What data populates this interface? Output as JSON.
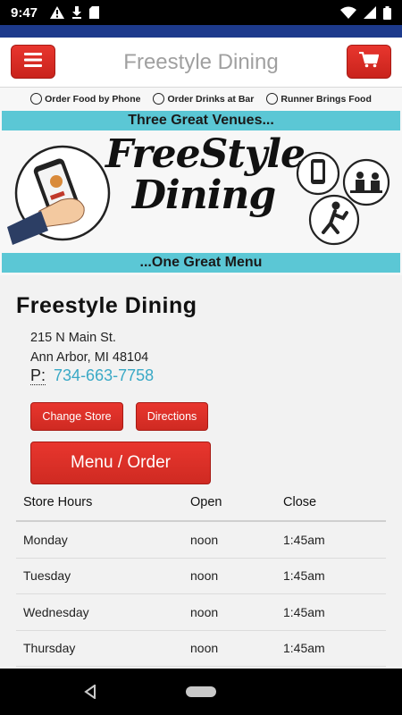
{
  "status_bar": {
    "time": "9:47",
    "left_icons": [
      "alert-icon",
      "download-icon",
      "sd-card-icon"
    ],
    "right_icons": [
      "wifi-icon",
      "signal-icon",
      "battery-icon"
    ]
  },
  "header": {
    "title": "Freestyle Dining",
    "menu_icon": "hamburger-icon",
    "cart_icon": "cart-icon"
  },
  "banner": {
    "steps": [
      "Order Food by Phone",
      "Order Drinks at Bar",
      "Runner Brings Food"
    ],
    "tagline_top": "Three Great Venues...",
    "logo_line1": "FreeStyle",
    "logo_line2": "Dining",
    "tagline_bottom": "...One Great Menu"
  },
  "store": {
    "name": "Freestyle Dining",
    "address_line1": "215 N Main St.",
    "address_line2": "Ann Arbor, MI 48104",
    "phone_prefix": "P:",
    "phone": "734-663-7758"
  },
  "buttons": {
    "change_store": "Change Store",
    "directions": "Directions",
    "menu_order": "Menu / Order"
  },
  "hours": {
    "headers": [
      "Store Hours",
      "Open",
      "Close"
    ],
    "rows": [
      {
        "day": "Monday",
        "open": "noon",
        "close": "1:45am"
      },
      {
        "day": "Tuesday",
        "open": "noon",
        "close": "1:45am"
      },
      {
        "day": "Wednesday",
        "open": "noon",
        "close": "1:45am"
      },
      {
        "day": "Thursday",
        "open": "noon",
        "close": "1:45am"
      }
    ]
  },
  "colors": {
    "accent_red": "#d8281f",
    "teal": "#5bc7d5",
    "link": "#3aa9c6",
    "top_strip": "#1d3a8c"
  }
}
